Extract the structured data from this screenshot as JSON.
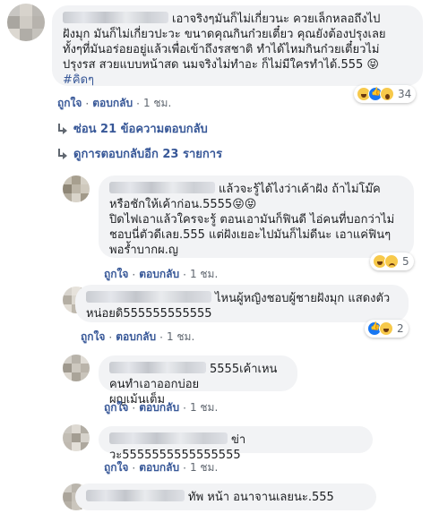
{
  "colors": {
    "link": "#385898",
    "bubble": "#f2f3f5",
    "meta": "#606770",
    "like_blue": "#1877f2",
    "haha_yellow": "#f7c94b"
  },
  "labels": {
    "like": "ถูกใจ",
    "reply": "ตอบกลับ",
    "dot": "·",
    "time": "1 ชม."
  },
  "main_comment": {
    "text": "เอาจริงๆมันก็ไม่เกี่ยวนะ ควยเล็กหลอถึงไป\nฝังมุก มันก็ไม่เกี่ยวปะวะ ขนาดคุณกินก๋วยเตี๋ยว คุณยังต้องปรุงเลย\nทั้งๆที่มันอร่อยอยู่แล้วเพื่อเข้าถึงรสชาติ ทำได้ไหมกินก๋วยเตี๋ยวไม่\nปรุงรส สวยแบบหน้าสด นมจริงไม่ทำอะ ก็ไม่มีใครทำได้.555 😝",
    "hashtag": "#คิดๆ",
    "reactions": {
      "icons": [
        "haha-icon",
        "like-icon",
        "wow-icon"
      ],
      "count": "34"
    }
  },
  "thread": {
    "hide_label": "ซ่อน 21 ข้อความตอบกลับ",
    "more_label": "ดูการตอบกลับอีก 23 รายการ"
  },
  "replies": [
    {
      "text": "แล้วจะรู้ได้ไงว่าเค้าฝัง ถ้าไม่โม๊ค\nหรือชักให้เค้าก่อน.5555😝😝\nปิดไฟเอาแล้วใครจะรู้ ตอนเอามันก็ฟินดี ไอ่คนที่บอกว่าไม่\nชอบนี่ตัวดีเลย.555 แต่ฝังเยอะไปมันก็ไม่ดีนะ เอาแค่ฟินๆ\nพอร้ำบากผ.ญ",
      "reactions": {
        "icons": [
          "haha-icon",
          "sad-icon"
        ],
        "count": "5"
      }
    },
    {
      "text": "ไหนผู้หญิงชอบผู้ชายฝังมุก แสดงตัว\nหน่อยดิ555555555555",
      "reactions": {
        "icons": [
          "like-icon",
          "haha-icon"
        ],
        "count": "2"
      }
    },
    {
      "text": "5555เค้าเหนคนทำเอาออกบ่อย\nผญเม้นเต็ม",
      "reactions": null
    },
    {
      "text": "ข่าวะ5555555555555555",
      "reactions": null
    },
    {
      "text": "ทัพ หน้า อนาจานเลยนะ.555",
      "reactions": null
    }
  ]
}
